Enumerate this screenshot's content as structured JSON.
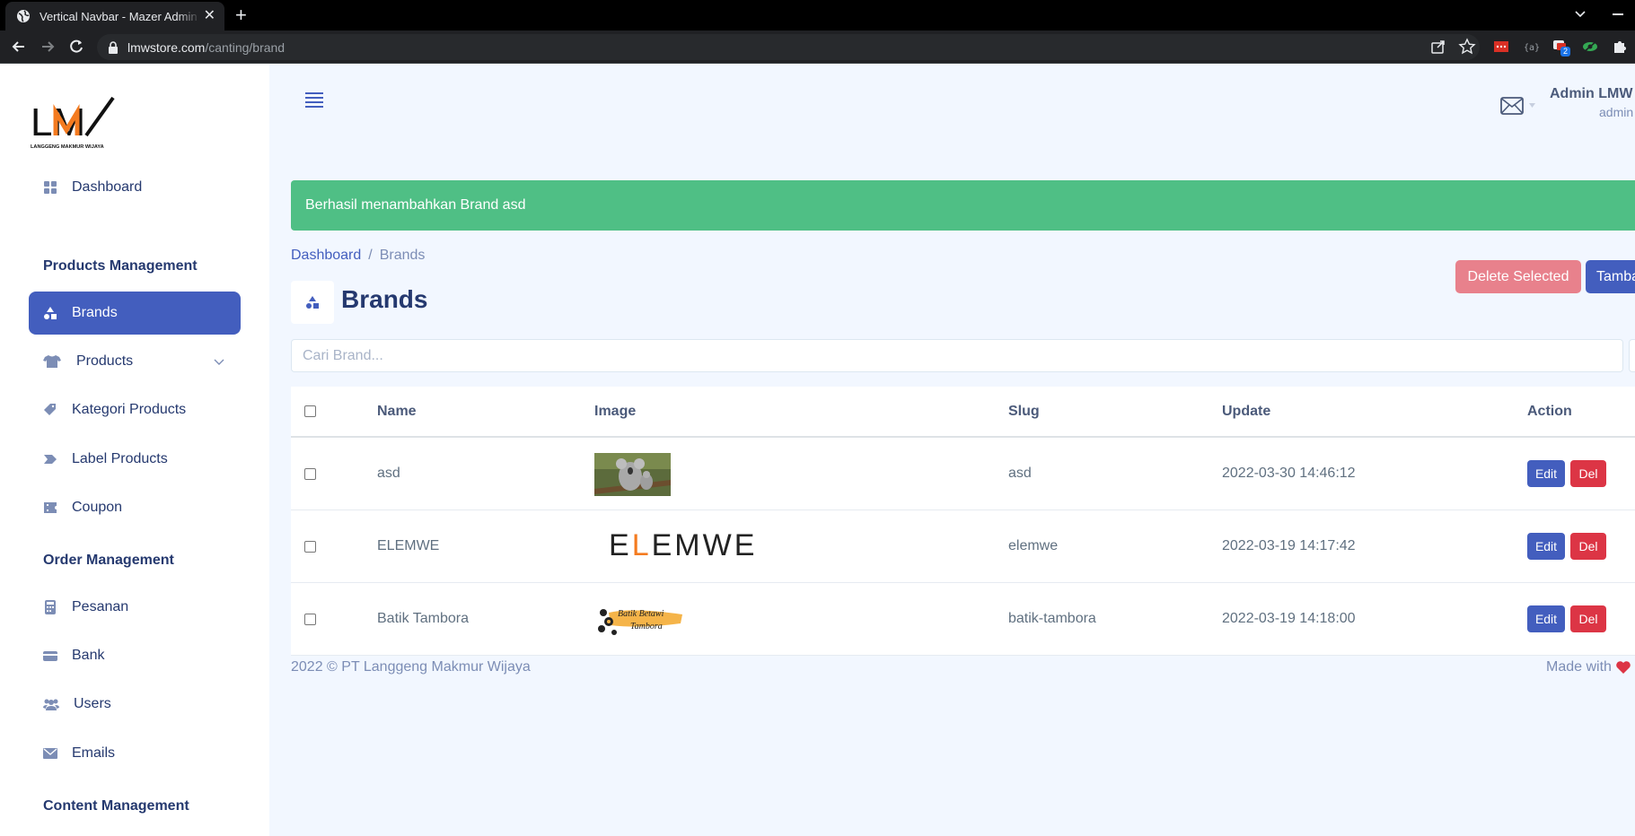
{
  "browser": {
    "tab_title": "Vertical Navbar - Mazer Admin Dashboard",
    "url_host": "lmwstore.com",
    "url_path": "/canting/brand",
    "extension_badge": "2"
  },
  "sidebar": {
    "logo_text": "LM",
    "logo_subtext": "LANGGENG MAKMUR WIJAYA",
    "items": [
      {
        "label": "Dashboard",
        "icon": "grid-icon"
      },
      {
        "label": "Brands",
        "icon": "shapes-icon",
        "active": true
      },
      {
        "label": "Products",
        "icon": "shirt-icon"
      },
      {
        "label": "Kategori Products",
        "icon": "tags-icon"
      },
      {
        "label": "Label Products",
        "icon": "tag-arrow-icon"
      },
      {
        "label": "Coupon",
        "icon": "ticket-icon"
      },
      {
        "label": "Pesanan",
        "icon": "calculator-icon"
      },
      {
        "label": "Bank",
        "icon": "credit-card-icon"
      },
      {
        "label": "Users",
        "icon": "people-icon"
      },
      {
        "label": "Emails",
        "icon": "envelope-icon"
      }
    ],
    "sections": {
      "products": "Products Management",
      "orders": "Order Management",
      "content": "Content Management"
    }
  },
  "header": {
    "user_name": "Admin LMW",
    "user_role": "admin"
  },
  "alert": {
    "message": "Berhasil menambahkan Brand asd"
  },
  "breadcrumb": {
    "home": "Dashboard",
    "separator": "/",
    "current": "Brands"
  },
  "page": {
    "title": "Brands",
    "delete_selected_label": "Delete Selected",
    "add_label": "Tambah Brand"
  },
  "search": {
    "placeholder": "Cari Brand..."
  },
  "table": {
    "columns": {
      "name": "Name",
      "image": "Image",
      "slug": "Slug",
      "update": "Update",
      "action": "Action"
    },
    "edit_label": "Edit",
    "del_label": "Del",
    "rows": [
      {
        "name": "asd",
        "slug": "asd",
        "update": "2022-03-30 14:46:12",
        "image": "koala-photo"
      },
      {
        "name": "ELEMWE",
        "slug": "elemwe",
        "update": "2022-03-19 14:17:42",
        "image": "elemwe-logo",
        "image_text": "ELEMWE"
      },
      {
        "name": "Batik Tambora",
        "slug": "batik-tambora",
        "update": "2022-03-19 14:18:00",
        "image": "batik-tambora-logo",
        "image_text_1": "Batik Betawi",
        "image_text_2": "Tambora"
      }
    ]
  },
  "footer": {
    "copyright": "2022 © PT Langgeng Makmur Wijaya",
    "made_with": "Made with"
  },
  "colors": {
    "primary": "#435ebe",
    "success": "#4fbf85",
    "danger": "#dc3545",
    "danger_light": "#e8818c",
    "bg": "#f2f7ff"
  }
}
